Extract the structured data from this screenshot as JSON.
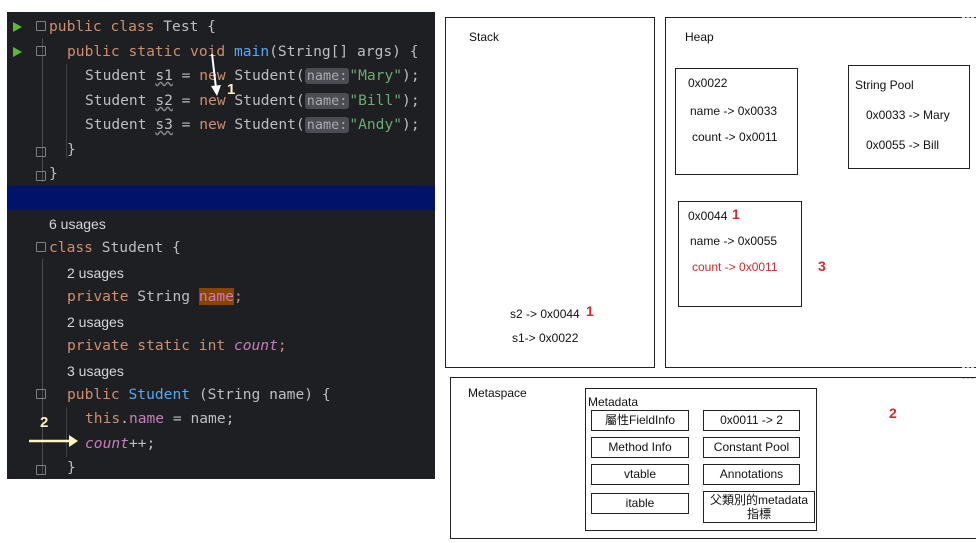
{
  "editor": {
    "lines": {
      "l1": {
        "kw1": "public",
        "kw2": "class",
        "name": "Test {"
      },
      "l2": {
        "kw1": "public",
        "kw2": "static",
        "kw3": "void",
        "fn": "main",
        "rest": "(String[] args) {"
      },
      "l3": {
        "type": "Student",
        "var": "s1",
        "eq": " = ",
        "kw": "new",
        "cls": " Student(",
        "hint": "name:",
        "str": "\"Mary\"",
        "end": ");"
      },
      "l4": {
        "type": "Student",
        "var": "s2",
        "eq": " = ",
        "kw": "new",
        "cls": " Student(",
        "hint": "name:",
        "str": "\"Bill\"",
        "end": ");"
      },
      "l5": {
        "type": "Student",
        "var": "s3",
        "eq": " = ",
        "kw": "new",
        "cls": " Student(",
        "hint": "name:",
        "str": "\"Andy\"",
        "end": ");"
      },
      "l6": {
        "text": "}"
      },
      "l7": {
        "text": "}"
      },
      "u1": "6 usages",
      "l8": {
        "kw": "class",
        "name": " Student {"
      },
      "u2": "2 usages",
      "l9": {
        "kw": "private",
        "type": " String ",
        "field": "name",
        "end": ";"
      },
      "u3": "2 usages",
      "l10": {
        "kw": "private static int",
        "field": "count",
        "end": ";"
      },
      "u4": "3 usages",
      "l11": {
        "kw": "public",
        "fn": "Student",
        "rest": " (String name) {"
      },
      "l12": {
        "kw": "this",
        "dot": ".",
        "field": "name",
        "rest": " = name;"
      },
      "l13": {
        "field": "count",
        "rest": "++;"
      },
      "l14": {
        "text": "}"
      }
    },
    "annotations": {
      "a1": "1",
      "a2": "2"
    }
  },
  "stack": {
    "title": "Stack",
    "entries": [
      "s2 -> 0x0044",
      "s1-> 0x0022"
    ],
    "marker": "1"
  },
  "heap": {
    "title": "Heap",
    "obj1": {
      "addr": "0x0022",
      "name": "name -> 0x0033",
      "count": "count -> 0x0011"
    },
    "obj2": {
      "addr": "0x0044",
      "addr_marker": "1",
      "name": "name -> 0x0055",
      "count": "count -> 0x0011",
      "count_marker": "3"
    },
    "string_pool": {
      "title": "String Pool",
      "entries": [
        "0x0033 -> Mary",
        "0x0055 -> Bill"
      ]
    }
  },
  "metaspace": {
    "title": "Metaspace",
    "metadata": {
      "title": "Metadata",
      "cells": [
        "屬性FieldInfo",
        "0x0011 -> 2",
        "Method Info",
        "Constant Pool",
        "vtable",
        "Annotations",
        "itable",
        "父類別的metadata指標"
      ]
    },
    "marker": "2"
  },
  "colors": {
    "red": "#e0222a",
    "editor_bg": "#1e1f22",
    "keyword": "#cf8e6d",
    "function": "#56a8f5",
    "string": "#6aab73",
    "field": "#c77dbb"
  }
}
